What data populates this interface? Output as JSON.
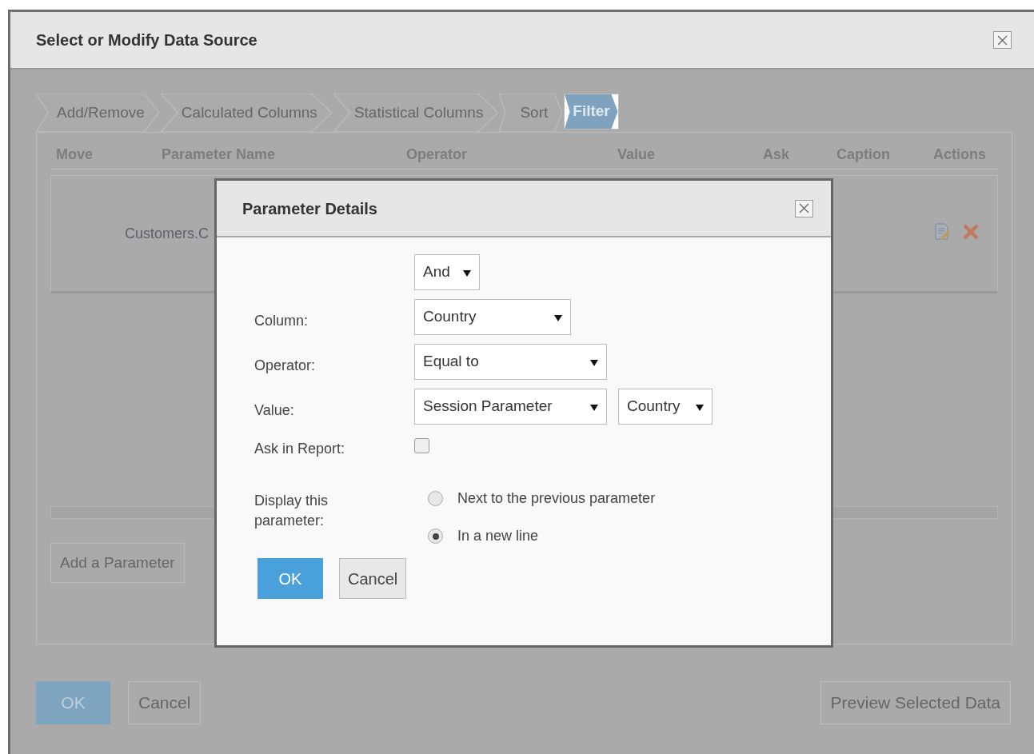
{
  "window": {
    "title": "Select or Modify Data Source"
  },
  "wizard_tabs": [
    {
      "label": "Add/Remove",
      "selected": false
    },
    {
      "label": "Calculated Columns",
      "selected": false
    },
    {
      "label": "Statistical Columns",
      "selected": false
    },
    {
      "label": "Sort",
      "selected": false
    },
    {
      "label": "Filter",
      "selected": true
    }
  ],
  "table": {
    "columns": [
      "Move",
      "Parameter Name",
      "Operator",
      "Value",
      "Ask",
      "Caption",
      "Actions"
    ],
    "rows": [
      {
        "parameter_name": "Customers.C"
      }
    ]
  },
  "add_button": "Add a Parameter",
  "buttons": [
    {
      "label": "OK",
      "kind": "primary"
    },
    {
      "label": "Cancel",
      "kind": "secondary"
    },
    {
      "label": "Preview Selected Data",
      "kind": "secondary"
    }
  ],
  "dialog": {
    "title": "Parameter Details",
    "conjunction": {
      "value": "And"
    },
    "fields": [
      {
        "label": "Column:",
        "selects": [
          {
            "value": "Country"
          }
        ]
      },
      {
        "label": "Operator:",
        "selects": [
          {
            "value": "Equal to"
          }
        ]
      },
      {
        "label": "Value:",
        "selects": [
          {
            "value": "Session Parameter"
          },
          {
            "value": "Country"
          }
        ]
      }
    ],
    "ask_in_report": {
      "label": "Ask in Report:",
      "checked": false
    },
    "display": {
      "label": "Display this parameter:",
      "options": [
        {
          "label": "Next to the previous parameter",
          "selected": false
        },
        {
          "label": "In a new line",
          "selected": true
        }
      ]
    },
    "buttons": [
      {
        "label": "OK",
        "kind": "primary"
      },
      {
        "label": "Cancel",
        "kind": "secondary"
      }
    ]
  }
}
